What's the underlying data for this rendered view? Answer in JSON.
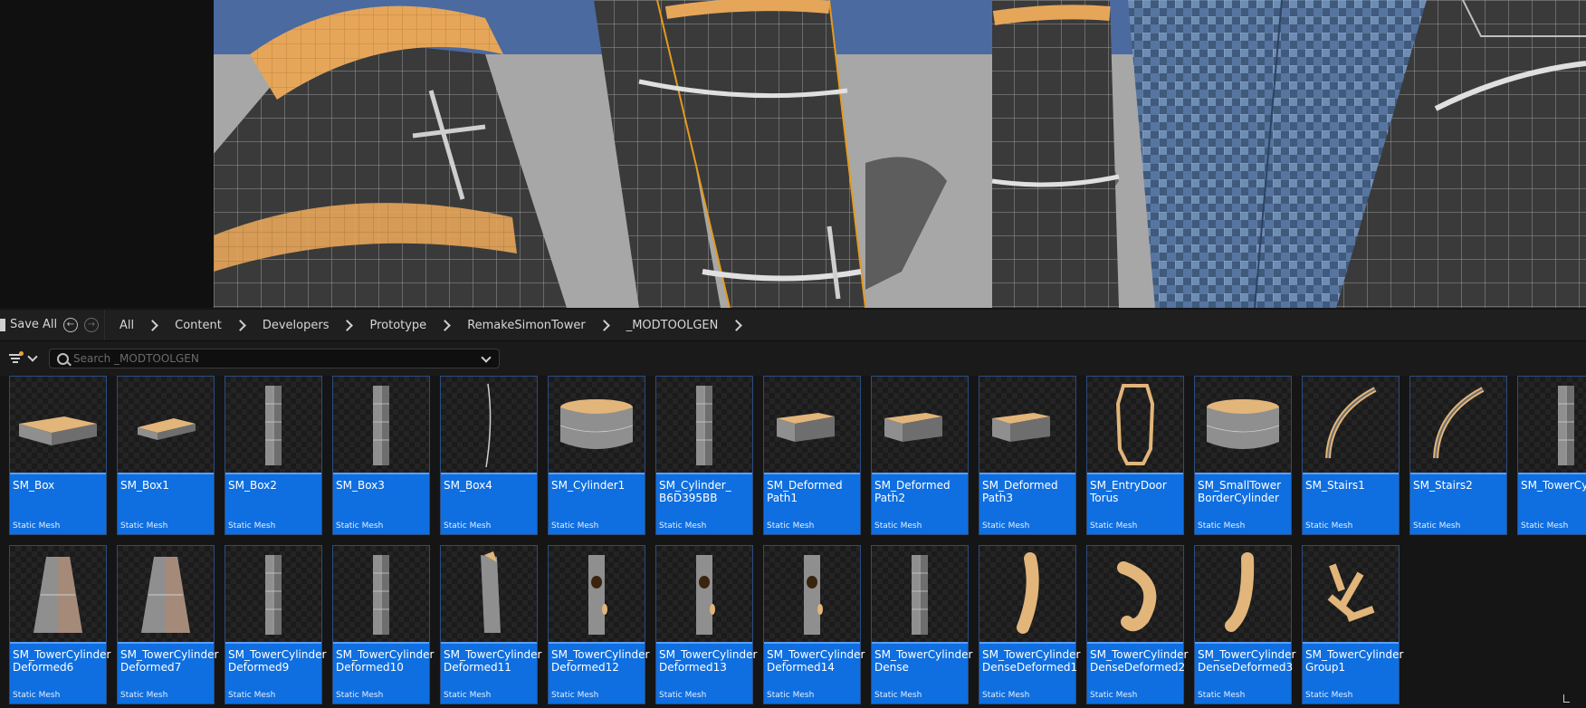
{
  "toolbar": {
    "save_all_label": "Save All",
    "back_icon": "back-arrow-icon",
    "forward_icon": "forward-arrow-icon",
    "breadcrumbs": [
      "All",
      "Content",
      "Developers",
      "Prototype",
      "RemakeSimonTower",
      "_MODTOOLGEN"
    ]
  },
  "search": {
    "placeholder": "Search _MODTOOLGEN",
    "value": ""
  },
  "colors": {
    "tile_label_bg": "#0f6fe0",
    "tile_label_border": "#5aa0ff",
    "filter_dot": "#e8a33a"
  },
  "assets": [
    {
      "name": "SM_Box",
      "type": "Static Mesh"
    },
    {
      "name": "SM_Box1",
      "type": "Static Mesh"
    },
    {
      "name": "SM_Box2",
      "type": "Static Mesh"
    },
    {
      "name": "SM_Box3",
      "type": "Static Mesh"
    },
    {
      "name": "SM_Box4",
      "type": "Static Mesh"
    },
    {
      "name": "SM_Cylinder1",
      "type": "Static Mesh"
    },
    {
      "name": "SM_Cylinder_\nB6D395BB",
      "type": "Static Mesh"
    },
    {
      "name": "SM_Deformed\nPath1",
      "type": "Static Mesh"
    },
    {
      "name": "SM_Deformed\nPath2",
      "type": "Static Mesh"
    },
    {
      "name": "SM_Deformed\nPath3",
      "type": "Static Mesh"
    },
    {
      "name": "SM_EntryDoor\nTorus",
      "type": "Static Mesh"
    },
    {
      "name": "SM_SmallTower\nBorderCylinder",
      "type": "Static Mesh"
    },
    {
      "name": "SM_Stairs1",
      "type": "Static Mesh"
    },
    {
      "name": "SM_Stairs2",
      "type": "Static Mesh"
    },
    {
      "name": "SM_TowerCy",
      "type": "Static Mesh"
    },
    {
      "name": "SM_TowerCylinder\nDeformed6",
      "type": "Static Mesh"
    },
    {
      "name": "SM_TowerCylinder\nDeformed7",
      "type": "Static Mesh"
    },
    {
      "name": "SM_TowerCylinder\nDeformed9",
      "type": "Static Mesh"
    },
    {
      "name": "SM_TowerCylinder\nDeformed10",
      "type": "Static Mesh"
    },
    {
      "name": "SM_TowerCylinder\nDeformed11",
      "type": "Static Mesh"
    },
    {
      "name": "SM_TowerCylinder\nDeformed12",
      "type": "Static Mesh"
    },
    {
      "name": "SM_TowerCylinder\nDeformed13",
      "type": "Static Mesh"
    },
    {
      "name": "SM_TowerCylinder\nDeformed14",
      "type": "Static Mesh"
    },
    {
      "name": "SM_TowerCylinder\nDense",
      "type": "Static Mesh"
    },
    {
      "name": "SM_TowerCylinder\nDenseDeformed1",
      "type": "Static Mesh"
    },
    {
      "name": "SM_TowerCylinder\nDenseDeformed2",
      "type": "Static Mesh"
    },
    {
      "name": "SM_TowerCylinder\nDenseDeformed3",
      "type": "Static Mesh"
    },
    {
      "name": "SM_TowerCylinder\nGroup1",
      "type": "Static Mesh"
    }
  ]
}
